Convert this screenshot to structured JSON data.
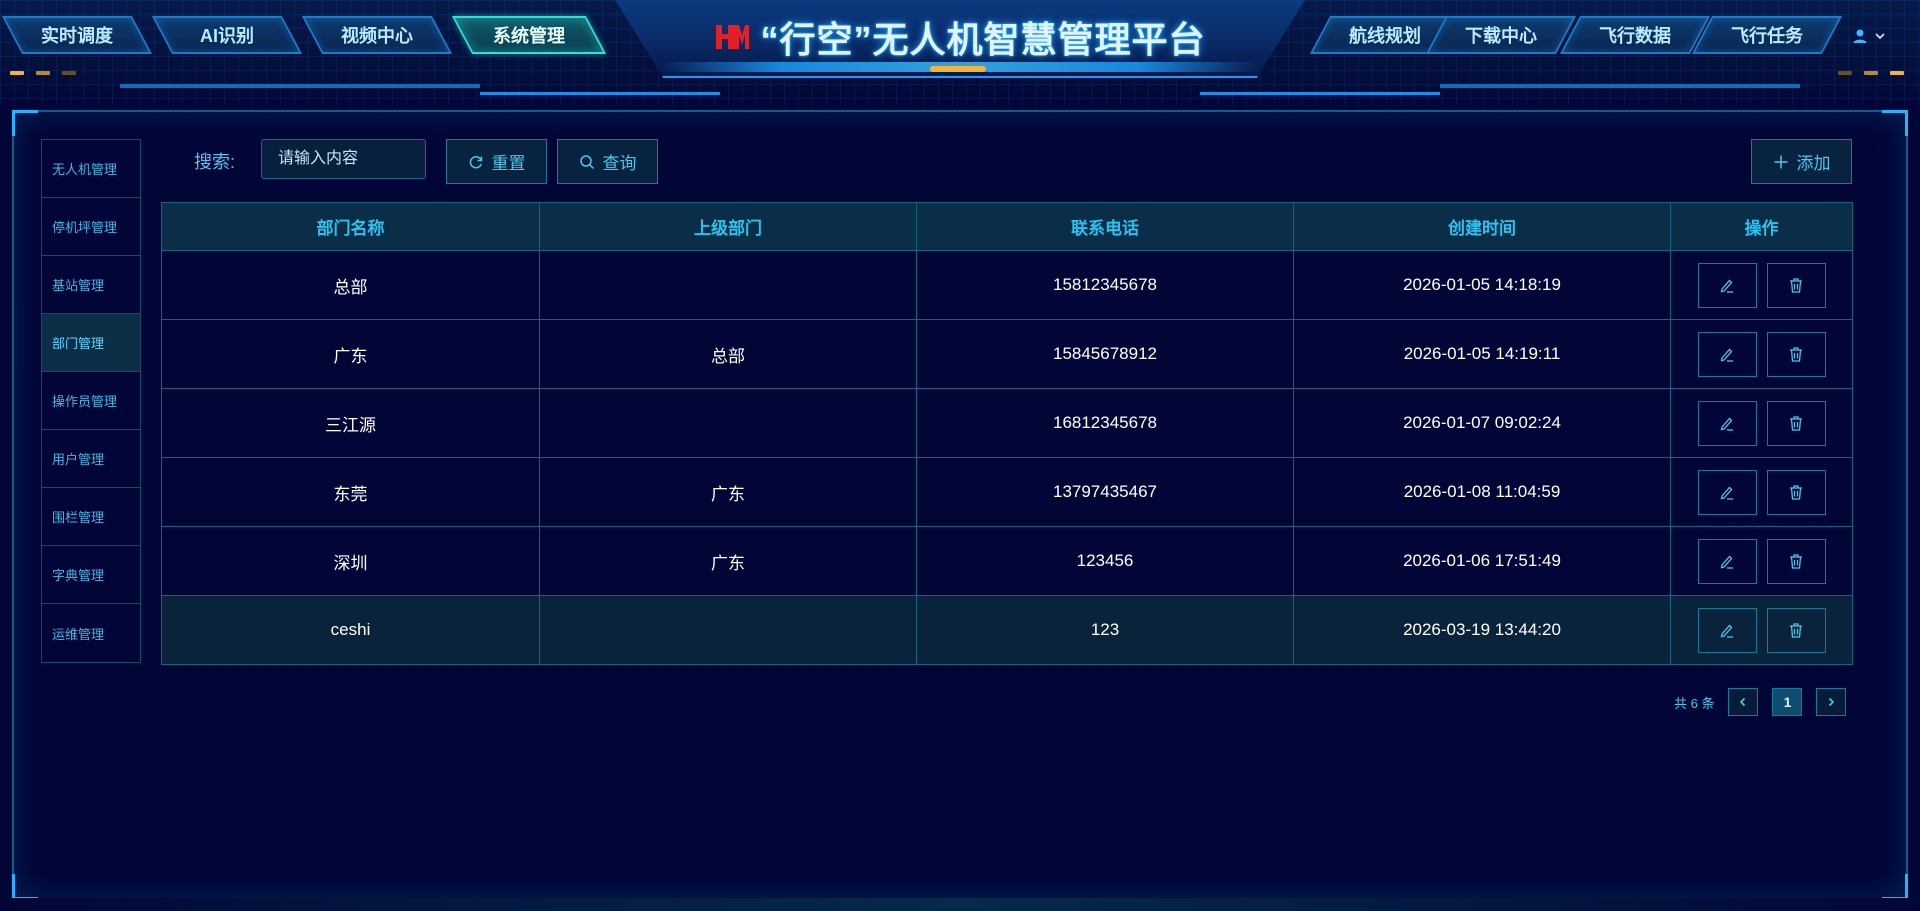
{
  "header": {
    "title": "“行空”无人机智慧管理平台",
    "logo_text": "HM",
    "left_tabs": [
      {
        "label": "实时调度",
        "active": false
      },
      {
        "label": "AI识别",
        "active": false
      },
      {
        "label": "视频中心",
        "active": false
      },
      {
        "label": "系统管理",
        "active": true
      }
    ],
    "right_tabs": [
      {
        "label": "航线规划"
      },
      {
        "label": "下载中心"
      },
      {
        "label": "飞行数据"
      },
      {
        "label": "飞行任务"
      }
    ],
    "user_icon": "user-icon",
    "dropdown_icon": "chevron-down-icon"
  },
  "sidebar": {
    "items": [
      {
        "label": "无人机管理",
        "active": false
      },
      {
        "label": "停机坪管理",
        "active": false
      },
      {
        "label": "基站管理",
        "active": false
      },
      {
        "label": "部门管理",
        "active": true
      },
      {
        "label": "操作员管理",
        "active": false
      },
      {
        "label": "用户管理",
        "active": false
      },
      {
        "label": "围栏管理",
        "active": false
      },
      {
        "label": "字典管理",
        "active": false
      },
      {
        "label": "运维管理",
        "active": false
      }
    ]
  },
  "toolbar": {
    "search_label": "搜索:",
    "search_placeholder": "请输入内容",
    "reset_label": "重置",
    "query_label": "查询",
    "add_label": "添加"
  },
  "table": {
    "columns": [
      "部门名称",
      "上级部门",
      "联系电话",
      "创建时间",
      "操作"
    ],
    "rows": [
      {
        "name": "总部",
        "parent": "",
        "phone": "15812345678",
        "created": "2026-01-05 14:18:19"
      },
      {
        "name": "广东",
        "parent": "总部",
        "phone": "15845678912",
        "created": "2026-01-05 14:19:11"
      },
      {
        "name": "三江源",
        "parent": "",
        "phone": "16812345678",
        "created": "2026-01-07 09:02:24"
      },
      {
        "name": "东莞",
        "parent": "广东",
        "phone": "13797435467",
        "created": "2026-01-08 11:04:59"
      },
      {
        "name": "深圳",
        "parent": "广东",
        "phone": "123456",
        "created": "2026-01-06 17:51:49"
      },
      {
        "name": "ceshi",
        "parent": "",
        "phone": "123",
        "created": "2026-03-19 13:44:20"
      }
    ]
  },
  "pagination": {
    "total_text": "共 6 条",
    "current_page": "1"
  },
  "colors": {
    "background": "#020637",
    "accent": "#2ac3f0",
    "active_tab": "#2fe0d5",
    "logo_red": "#e0202a",
    "title_glow": "#1aa0ff"
  }
}
